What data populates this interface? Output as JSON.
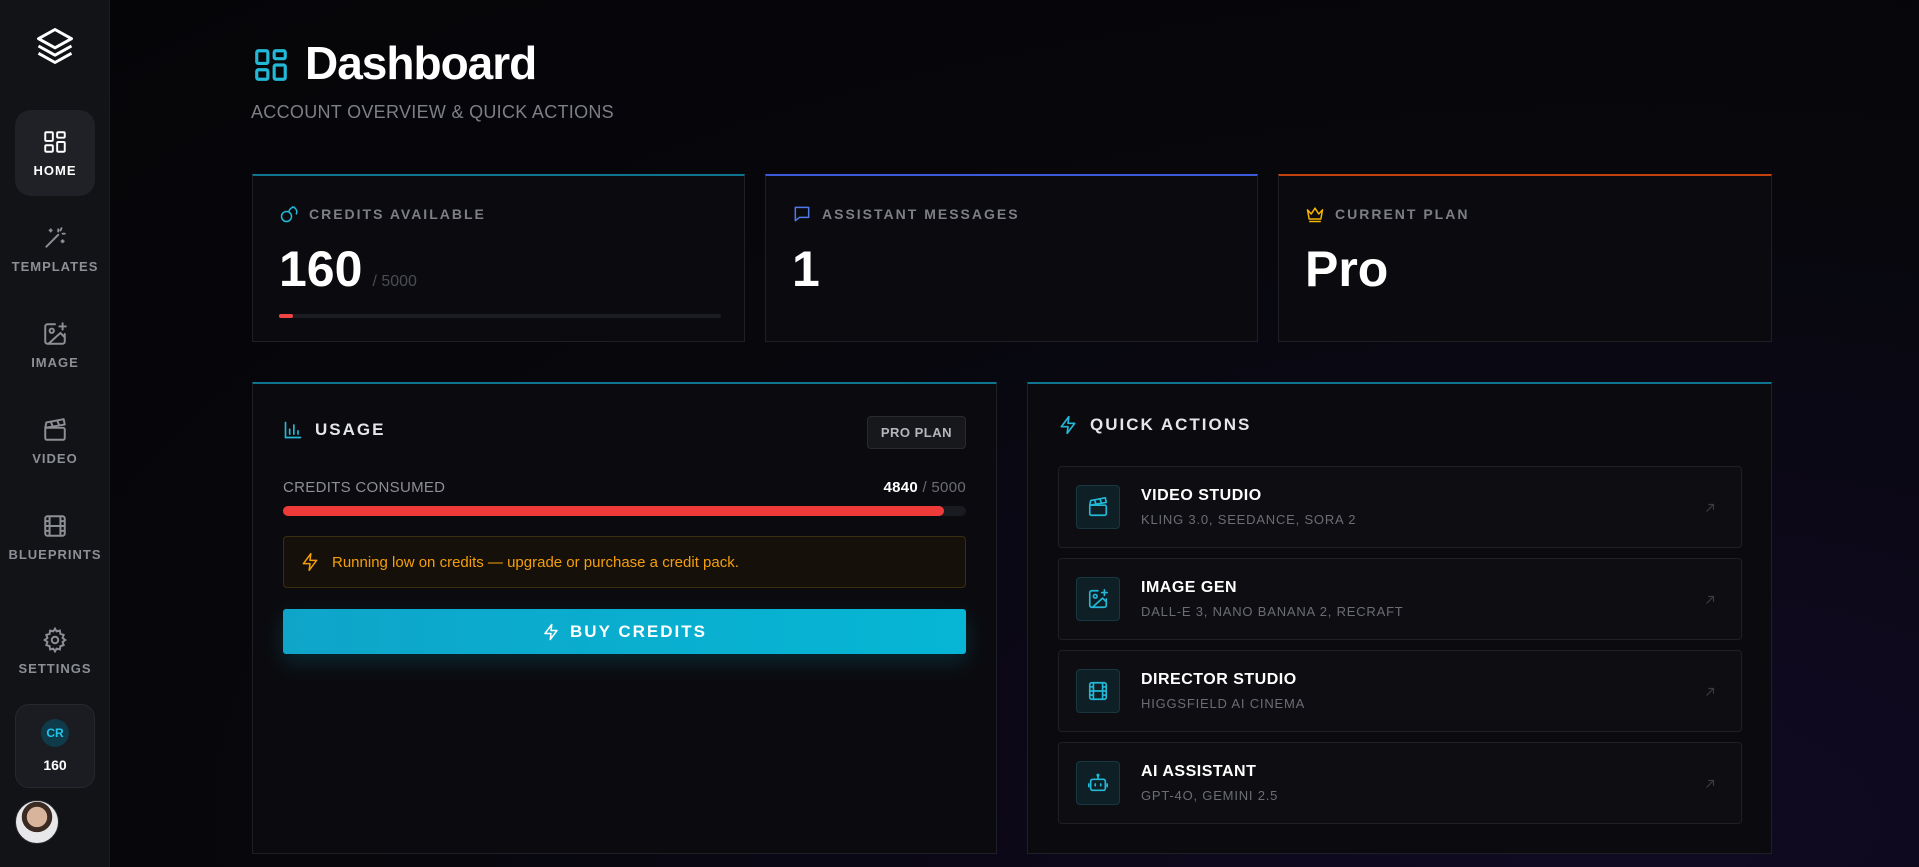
{
  "sidebar": {
    "items": [
      {
        "label": "HOME",
        "icon": "grid-icon",
        "active": true
      },
      {
        "label": "TEMPLATES",
        "icon": "magic-wand-icon"
      },
      {
        "label": "IMAGE",
        "icon": "image-plus-icon"
      },
      {
        "label": "VIDEO",
        "icon": "clapperboard-icon"
      },
      {
        "label": "BLUEPRINTS",
        "icon": "film-icon"
      },
      {
        "label": "SETTINGS",
        "icon": "gear-icon"
      }
    ],
    "credit_badge": "CR",
    "credit_count": "160"
  },
  "header": {
    "title": "Dashboard",
    "subtitle": "ACCOUNT OVERVIEW & QUICK ACTIONS"
  },
  "stats": {
    "credits": {
      "label": "CREDITS AVAILABLE",
      "value": "160",
      "sub": "/ 5000",
      "fraction": 0.032,
      "accent": "#0e7490"
    },
    "messages": {
      "label": "ASSISTANT MESSAGES",
      "value": "1",
      "accent": "#3b5bdb"
    },
    "plan": {
      "label": "CURRENT PLAN",
      "value": "Pro",
      "accent": "#c2410c"
    }
  },
  "usage": {
    "title": "USAGE",
    "plan_pill": "PRO PLAN",
    "consumed_label": "CREDITS CONSUMED",
    "consumed_value": "4840",
    "consumed_total": "/ 5000",
    "fraction": 0.968,
    "warning": "Running low on credits — upgrade or purchase a credit pack.",
    "buy_label": "BUY CREDITS"
  },
  "quick_actions": {
    "title": "QUICK ACTIONS",
    "items": [
      {
        "title": "VIDEO STUDIO",
        "sub": "KLING 3.0, SEEDANCE, SORA 2",
        "icon": "clapperboard-icon"
      },
      {
        "title": "IMAGE GEN",
        "sub": "DALL-E 3, NANO BANANA 2, RECRAFT",
        "icon": "image-plus-icon"
      },
      {
        "title": "DIRECTOR STUDIO",
        "sub": "HIGGSFIELD AI CINEMA",
        "icon": "film-icon"
      },
      {
        "title": "AI ASSISTANT",
        "sub": "GPT-4O, GEMINI 2.5",
        "icon": "bot-icon"
      }
    ]
  },
  "colors": {
    "accent": "#06b6d4",
    "danger": "#ef4444",
    "warning": "#f59e0b",
    "plan_gold": "#f5b400"
  }
}
